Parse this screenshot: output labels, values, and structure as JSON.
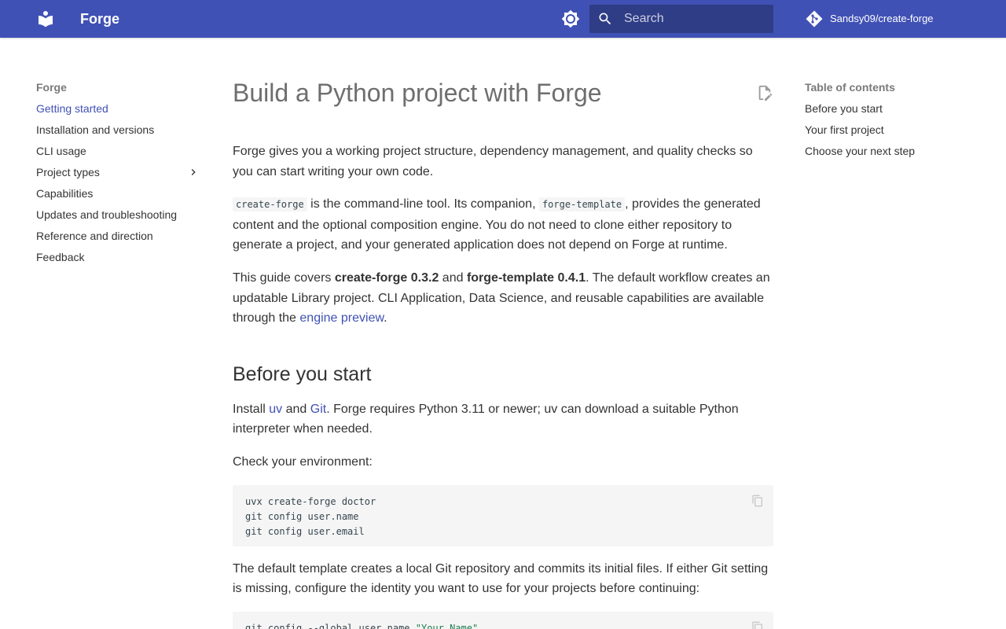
{
  "header": {
    "site_title": "Forge",
    "search_placeholder": "Search",
    "repo_name": "Sandsy09/create-forge",
    "accent_color": "#4051b5"
  },
  "nav": {
    "title": "Forge",
    "items": [
      {
        "label": "Getting started",
        "active": true
      },
      {
        "label": "Installation and versions"
      },
      {
        "label": "CLI usage"
      },
      {
        "label": "Project types",
        "expandable": true
      },
      {
        "label": "Capabilities"
      },
      {
        "label": "Updates and troubleshooting"
      },
      {
        "label": "Reference and direction"
      },
      {
        "label": "Feedback"
      }
    ]
  },
  "content": {
    "title": "Build a Python project with Forge",
    "intro": "Forge gives you a working project structure, dependency management, and quality checks so you can start writing your own code.",
    "para2": {
      "code1": "create-forge",
      "text1": " is the command-line tool. Its companion, ",
      "code2": "forge-template",
      "text2": ", provides the generated content and the optional composition engine. You do not need to clone either repository to generate a project, and your generated application does not depend on Forge at runtime."
    },
    "para3": {
      "text1": "This guide covers ",
      "bold1": "create-forge 0.3.2",
      "text2": " and ",
      "bold2": "forge-template 0.4.1",
      "text3": ". The default workflow creates an updatable Library project. CLI Application, Data Science, and reusable capabilities are available through the ",
      "link": "engine preview",
      "text4": "."
    },
    "section1_heading": "Before you start",
    "para4": {
      "text1": "Install ",
      "link1": "uv",
      "text2": " and ",
      "link2": "Git",
      "text3": ". Forge requires Python 3.11 or newer; uv can download a suitable Python interpreter when needed."
    },
    "para5": "Check your environment:",
    "code_block1": [
      "uvx create-forge doctor",
      "git config user.name",
      "git config user.email"
    ],
    "para6": "The default template creates a local Git repository and commits its initial files. If either Git setting is missing, configure the identity you want to use for your projects before continuing:",
    "code_block2": {
      "line1_prefix": "git config --global user.name ",
      "line1_string": "\"Your Name\""
    }
  },
  "toc": {
    "title": "Table of contents",
    "items": [
      "Before you start",
      "Your first project",
      "Choose your next step"
    ]
  }
}
